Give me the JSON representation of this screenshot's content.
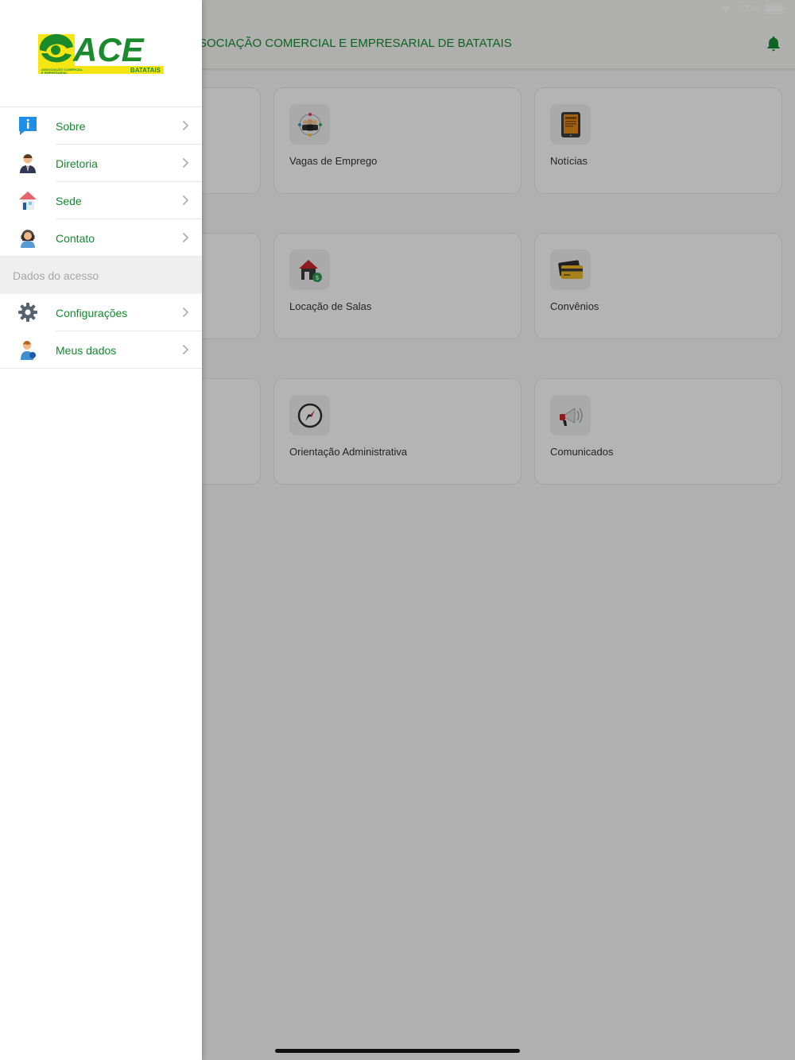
{
  "status": {
    "battery_text": "100%"
  },
  "header": {
    "title": "ASSOCIAÇÃO COMERCIAL E EMPRESARIAL DE BATATAIS"
  },
  "grid": {
    "cards": [
      {
        "label": "Vagas de Emprego",
        "icon": "team-network-icon"
      },
      {
        "label": "Notícias",
        "icon": "newspaper-tablet-icon"
      },
      {
        "label": "Locação de Salas",
        "icon": "house-rent-icon"
      },
      {
        "label": "Convênios",
        "icon": "credit-card-icon"
      },
      {
        "label": "Orientação Administrativa",
        "icon": "compass-icon"
      },
      {
        "label": "Comunicados",
        "icon": "megaphone-icon"
      }
    ]
  },
  "drawer": {
    "logo": {
      "text": "ACE",
      "sub": "BATATAIS",
      "tagline": "ASSOCIAÇÃO COMERCIAL E EMPRESARIAL"
    },
    "items": [
      {
        "label": "Sobre",
        "icon": "info-icon"
      },
      {
        "label": "Diretoria",
        "icon": "businessman-icon"
      },
      {
        "label": "Sede",
        "icon": "house-icon"
      },
      {
        "label": "Contato",
        "icon": "operator-icon"
      }
    ],
    "section_label": "Dados do acesso",
    "account_items": [
      {
        "label": "Configurações",
        "icon": "gear-icon"
      },
      {
        "label": "Meus dados",
        "icon": "user-icon"
      }
    ]
  },
  "colors": {
    "accent": "#128a2d",
    "logo_yellow": "#f5e613",
    "logo_green": "#1b8a2c"
  }
}
